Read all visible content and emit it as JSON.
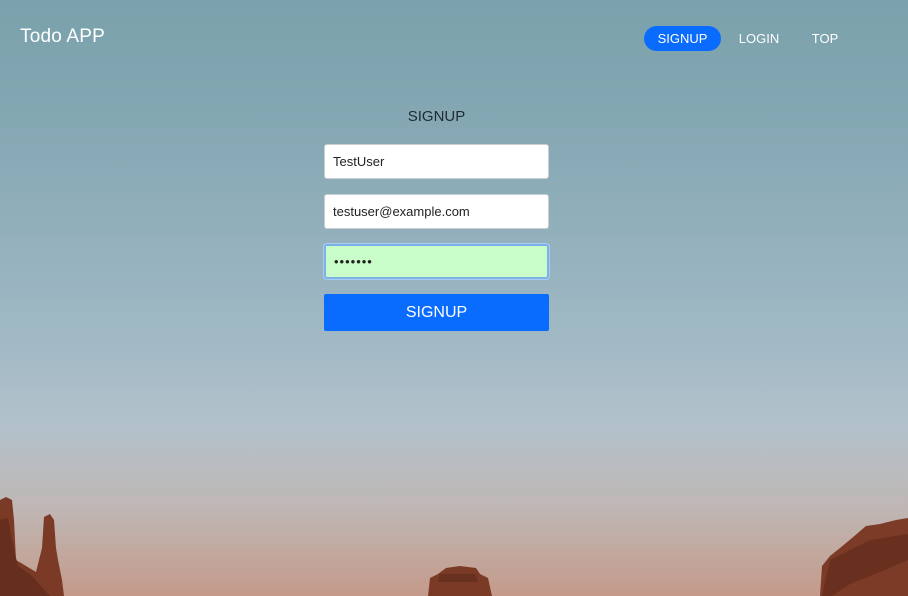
{
  "header": {
    "brand": "Todo APP",
    "nav": [
      {
        "label": "SIGNUP",
        "active": true
      },
      {
        "label": "LOGIN",
        "active": false
      },
      {
        "label": "TOP",
        "active": false
      }
    ]
  },
  "form": {
    "title": "SIGNUP",
    "fields": {
      "username": {
        "value": "TestUser"
      },
      "email": {
        "value": "testuser@example.com"
      },
      "password": {
        "value": "•••••••"
      }
    },
    "submit_label": "SIGNUP"
  },
  "colors": {
    "accent": "#0a6cff",
    "autofill": "#c8fcc8"
  }
}
